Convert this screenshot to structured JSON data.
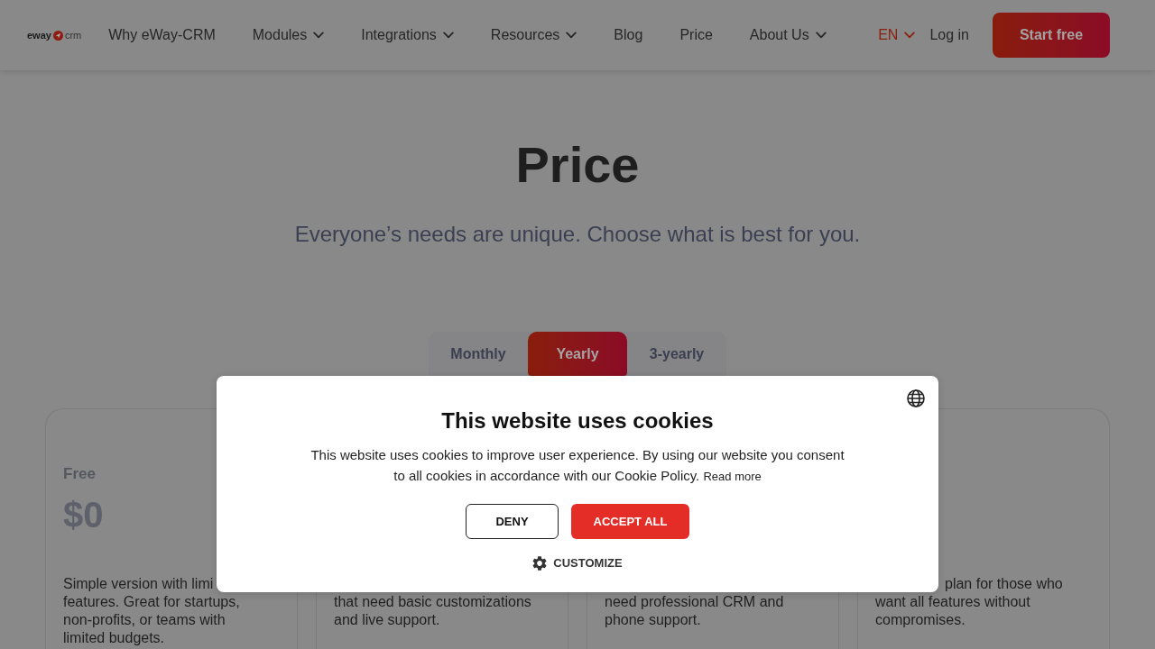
{
  "header": {
    "logo": {
      "wordmark": "eway",
      "suffix": "crm"
    },
    "nav": [
      {
        "label": "Why eWay-CRM",
        "has_dropdown": false
      },
      {
        "label": "Modules",
        "has_dropdown": true
      },
      {
        "label": "Integrations",
        "has_dropdown": true
      },
      {
        "label": "Resources",
        "has_dropdown": true
      },
      {
        "label": "Blog",
        "has_dropdown": false
      },
      {
        "label": "Price",
        "has_dropdown": false
      },
      {
        "label": "About Us",
        "has_dropdown": true
      }
    ],
    "language": {
      "label": "EN"
    },
    "login": "Log in",
    "cta": "Start free"
  },
  "hero": {
    "title": "Price",
    "subtitle": "Everyone’s needs are unique. Choose what is best for you."
  },
  "billing_tabs": [
    {
      "label": "Monthly",
      "selected": false
    },
    {
      "label": "Yearly",
      "selected": true
    },
    {
      "label": "3-yearly",
      "selected": false
    }
  ],
  "plans": [
    {
      "name": "Free",
      "price": "$0",
      "description_lines": [
        "Simple version with limi",
        "features. Great for startups,",
        "non-profits, or teams with",
        "limited budgets."
      ]
    },
    {
      "description_lines": [
        "that need basic customizations",
        "and live support."
      ]
    },
    {
      "description_lines": [
        "need professional CRM and",
        "phone support."
      ]
    },
    {
      "description_lines": [
        "plan for those who",
        "want all features without",
        "compromises."
      ]
    }
  ],
  "cookie_dialog": {
    "title": "This website uses cookies",
    "text": "This website uses cookies to improve user experience. By using our website you consent to all cookies in accordance with our Cookie Policy.",
    "link": "Read more",
    "buttons": [
      {
        "label": "DENY",
        "kind": "outline"
      },
      {
        "label": "ACCEPT ALL",
        "kind": "filled"
      }
    ],
    "customize": "CUSTOMIZE"
  }
}
